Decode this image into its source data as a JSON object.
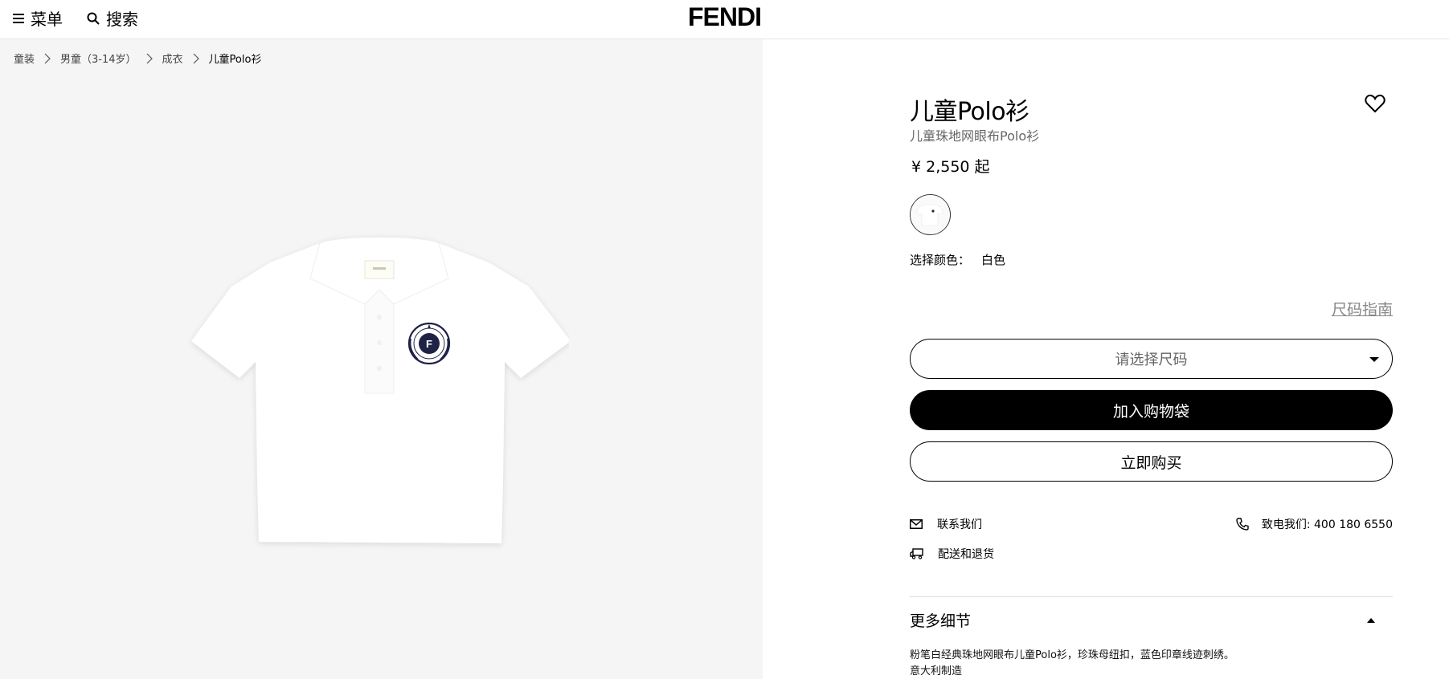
{
  "header": {
    "menu_label": "菜单",
    "search_label": "搜索",
    "logo": "FENDI"
  },
  "breadcrumb": [
    {
      "label": "童装"
    },
    {
      "label": "男童（3-14岁）"
    },
    {
      "label": "成衣"
    },
    {
      "label": "儿童Polo衫"
    }
  ],
  "product": {
    "title": "儿童Polo衫",
    "subtitle": "儿童珠地网眼布Polo衫",
    "price": "¥ 2,550 起",
    "color_label": "选择颜色：",
    "color_value": "白色",
    "size_guide": "尺码指南",
    "size_placeholder": "请选择尺码",
    "add_to_bag": "加入购物袋",
    "buy_now": "立即购买"
  },
  "service": {
    "contact": "联系我们",
    "phone": "致电我们: 400 180 6550",
    "shipping": "配送和退货"
  },
  "details": {
    "heading": "更多细节",
    "line1": "粉笔白经典珠地网眼布儿童Polo衫，珍珠母纽扣，蓝色印章线迹刺绣。",
    "line2": "意大利制造"
  },
  "icons": {
    "menu": "hamburger-icon",
    "search": "search-icon",
    "favorite": "heart-icon",
    "contact": "mail-icon",
    "phone": "phone-icon",
    "shipping": "truck-icon"
  },
  "colors": {
    "background_image_panel": "#f5f5f5",
    "primary_button": "#000000",
    "muted_text": "#666666"
  }
}
